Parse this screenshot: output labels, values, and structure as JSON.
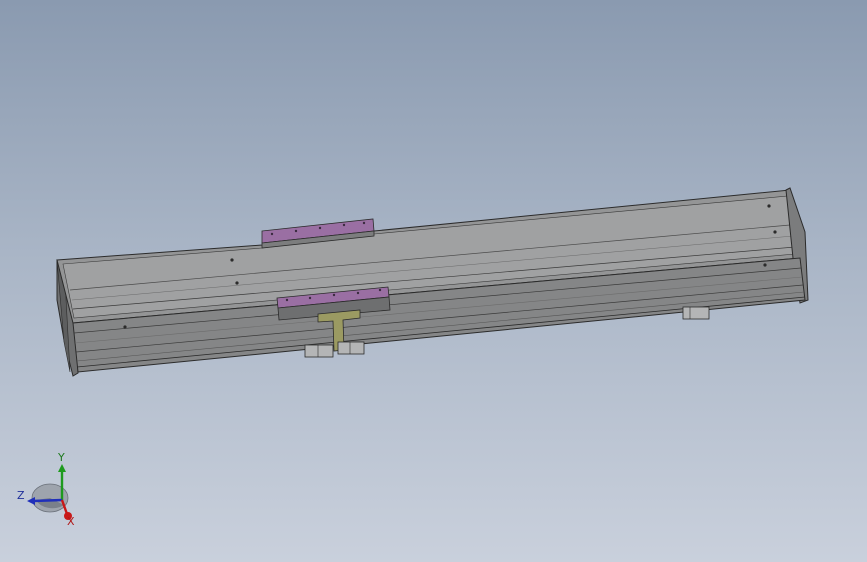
{
  "viewport": {
    "background_top": "#8a9ab0",
    "background_bottom": "#c9d0dc"
  },
  "model": {
    "body_color": "#8d8e8f",
    "edge_color": "#2b2b2b",
    "carriage_color": "#7c7d7e",
    "plate_color": "#9a6fa3",
    "bracket_color": "#9b9a62"
  },
  "triad": {
    "y_label": "Y",
    "z_label": "Z",
    "x_label": "X",
    "y_color": "#1e9a1e",
    "z_color": "#1f2fba",
    "x_color": "#c81818"
  }
}
